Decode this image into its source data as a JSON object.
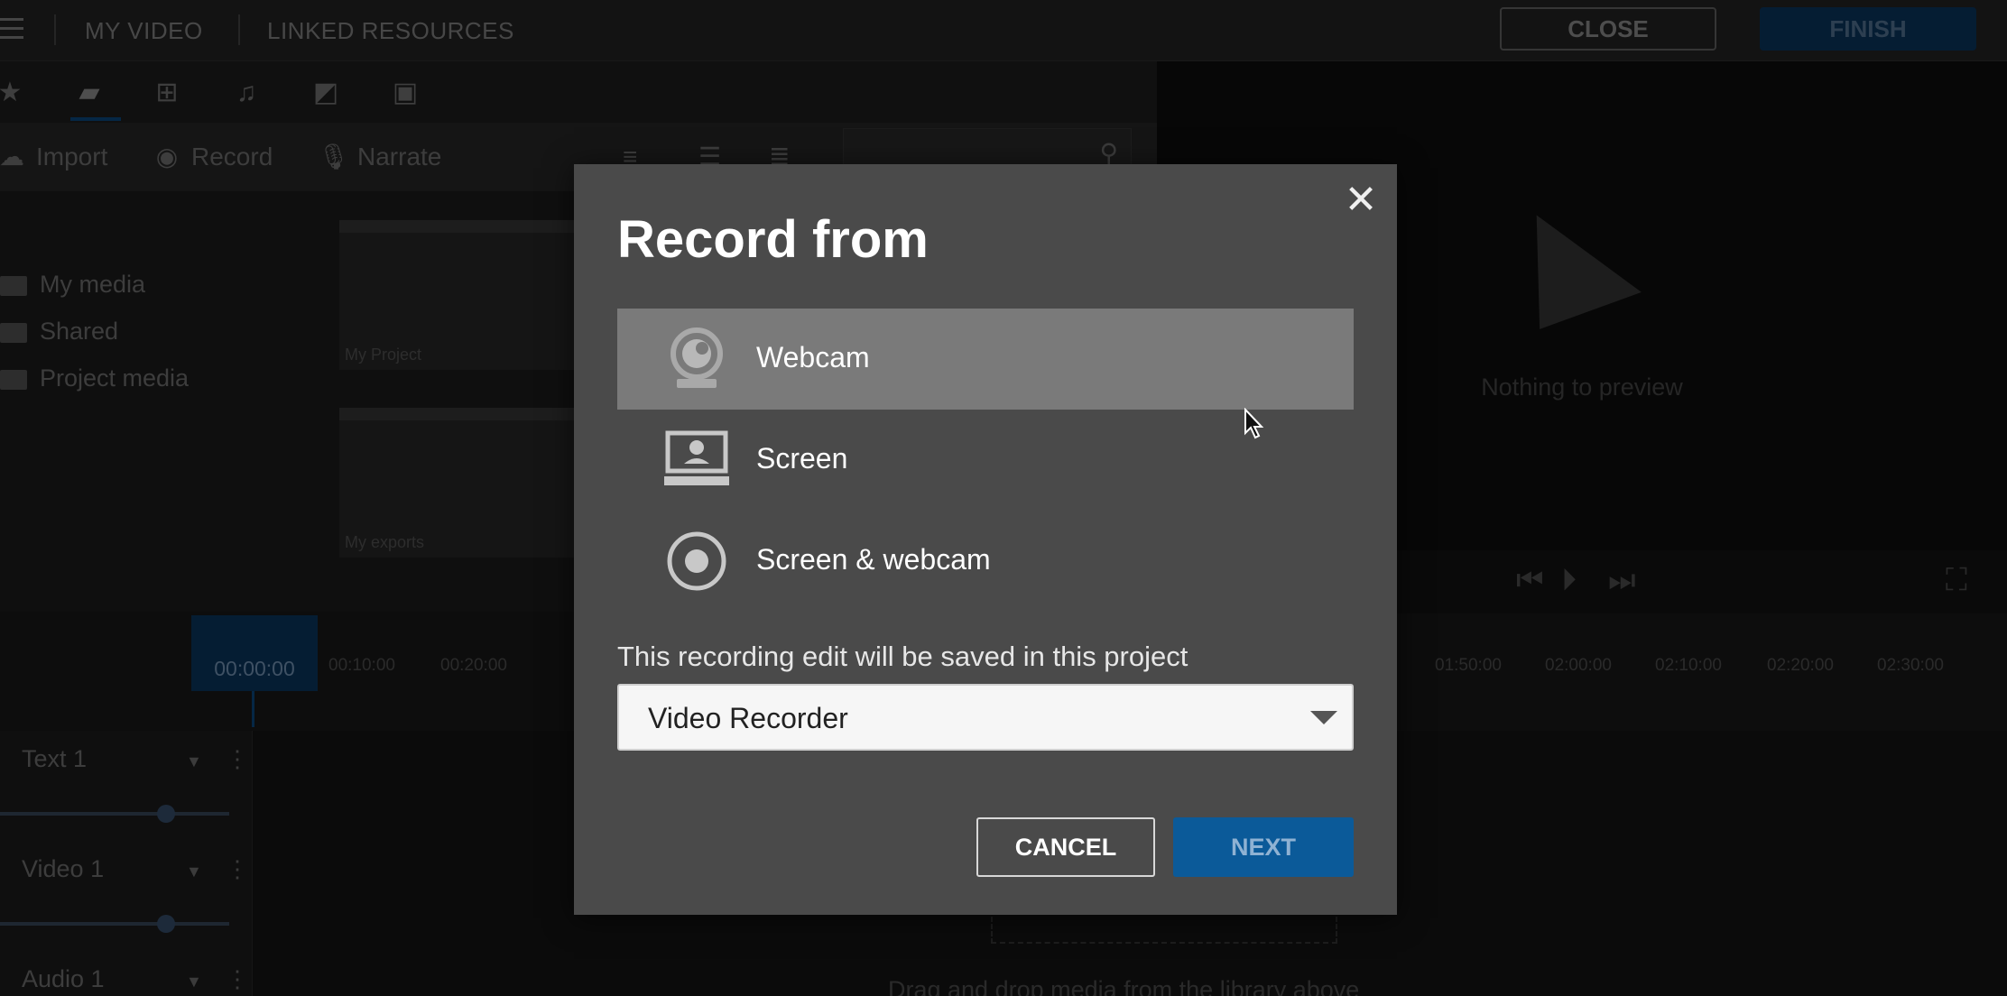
{
  "topbar": {
    "nav_my_video": "MY VIDEO",
    "nav_linked_resources": "LINKED RESOURCES",
    "close_label": "CLOSE",
    "finish_label": "FINISH"
  },
  "library": {
    "tools": {
      "import": "Import",
      "record": "Record",
      "narrate": "Narrate"
    },
    "folders": [
      "My media",
      "Shared",
      "Project media"
    ],
    "thumbs": [
      "My Project",
      "My exports"
    ]
  },
  "preview": {
    "empty_text": "Nothing to preview"
  },
  "timeline": {
    "playhead_time": "00:00:00",
    "ticks_left": [
      "00:10:00",
      "00:20:00"
    ],
    "ticks_right": [
      "01:50:00",
      "02:00:00",
      "02:10:00",
      "02:20:00",
      "02:30:00"
    ],
    "tracks": [
      "Text 1",
      "Video 1",
      "Audio 1"
    ],
    "drop_text": "Drag and drop media from the library above"
  },
  "modal": {
    "title": "Record from",
    "options": [
      {
        "label": "Webcam",
        "icon": "webcam-icon",
        "selected": true
      },
      {
        "label": "Screen",
        "icon": "screen-icon",
        "selected": false
      },
      {
        "label": "Screen & webcam",
        "icon": "screen-webcam-icon",
        "selected": false
      }
    ],
    "save_note": "This recording edit will be saved in this project",
    "project_select_value": "Video Recorder",
    "cancel_label": "CANCEL",
    "next_label": "NEXT"
  },
  "colors": {
    "accent": "#0b5a99",
    "modal_bg": "#4a4a4a",
    "selected_option_bg": "#7a7a7a"
  }
}
